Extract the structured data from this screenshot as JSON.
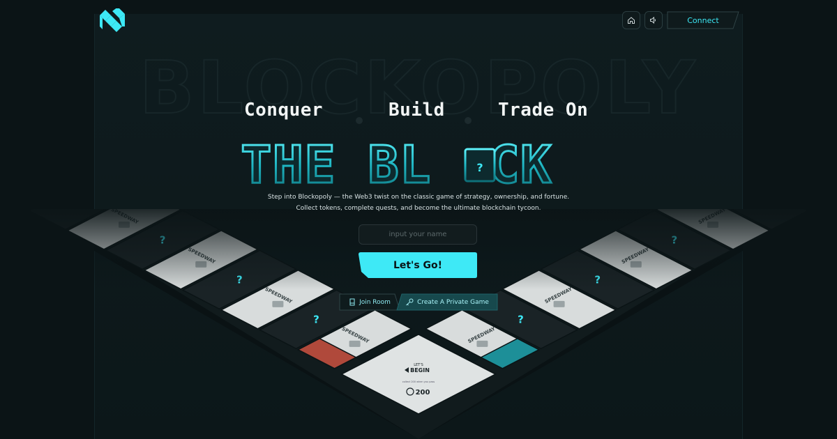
{
  "header": {
    "home_icon": "home-icon",
    "sound_icon": "speaker-icon",
    "connect_label": "Connect"
  },
  "watermark": "BLOCKOPOLY",
  "hero": {
    "taglines": [
      "Conquer",
      "Build",
      "Trade On"
    ],
    "title_part1": "THE BL",
    "title_mystery": "?",
    "title_part2": "CK",
    "description_line1": "Step into Blockopoly — the Web3 twist on the classic game of strategy, ownership, and fortune.",
    "description_line2": "Collect tokens, complete quests, and become the ultimate blockchain tycoon."
  },
  "form": {
    "name_placeholder": "input your name",
    "name_value": "",
    "go_label": "Let's Go!",
    "join_label": "Join Room",
    "create_label": "Create A Private Game"
  },
  "board": {
    "tile_label": "SPEEDWAY",
    "mystery_mark": "?",
    "start_top": "LET'S",
    "start_main": "BEGIN",
    "start_amount": "200",
    "start_caption": "collect 200 when you pass"
  },
  "colors": {
    "accent": "#3de8f5",
    "background": "#0b1416",
    "tile_light": "#d8dcdc",
    "tile_dark": "#1a2326",
    "tile_red": "#b0493b",
    "tile_teal": "#1d8f98"
  }
}
